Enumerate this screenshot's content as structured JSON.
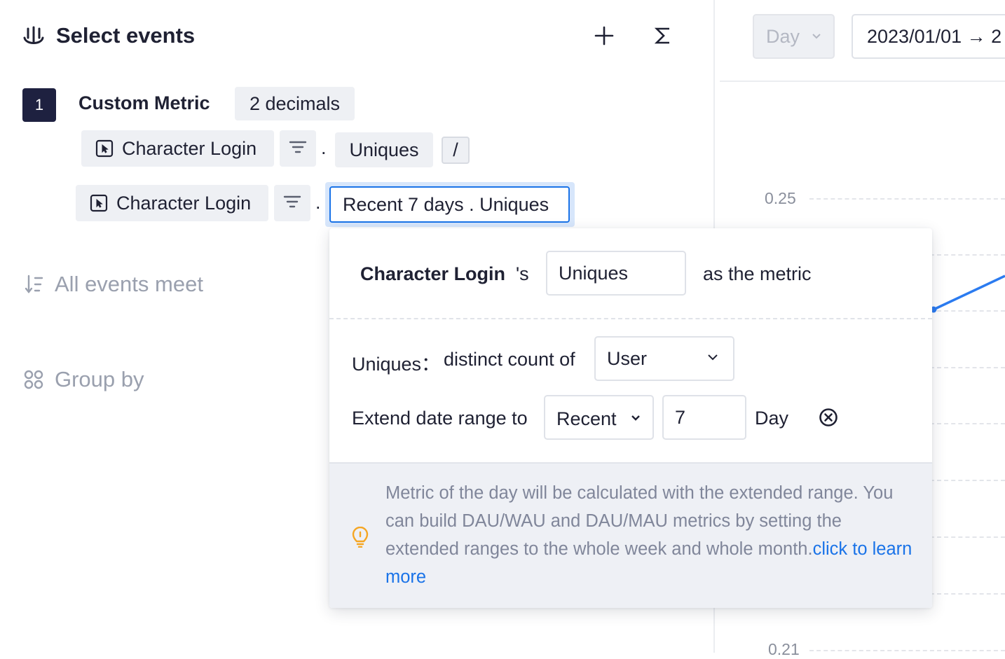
{
  "header": {
    "title": "Select events",
    "add_icon": "plus-icon",
    "formula_icon": "sigma-icon",
    "events_icon": "anchor-icon"
  },
  "metric": {
    "index": "1",
    "name": "Custom Metric",
    "decimals": "2 decimals",
    "row1": {
      "event": "Character Login",
      "separator": ".",
      "measure": "Uniques",
      "operator": "/"
    },
    "row2": {
      "event": "Character Login",
      "separator": ".",
      "measure": "Recent 7 days . Uniques"
    }
  },
  "sections": {
    "all_events": "All events meet",
    "group_by": "Group by"
  },
  "toolbar": {
    "granularity": "Day",
    "date_range": "2023/01/01 → 2"
  },
  "chart": {
    "tick_top": "0.25",
    "tick_bottom": "0.21",
    "line_color": "#2b7bf0"
  },
  "popup": {
    "event_name": "Character Login",
    "possessive": "'s",
    "metric_value": "Uniques",
    "as_metric": "as the metric",
    "uniques_label": "Uniques：",
    "distinct_label": "distinct count of",
    "distinct_value": "User",
    "extend_label": "Extend date range to",
    "range_mode": "Recent",
    "range_amount": "7",
    "range_unit": "Day",
    "tip_text": "Metric of the day will be calculated with the extended range. You can build DAU/WAU and DAU/MAU metrics by setting the extended ranges to the whole week and whole month.",
    "tip_link": "click to learn more"
  },
  "colors": {
    "accent": "#1a73e8",
    "index_badge": "#1e2140",
    "tip_bulb": "#f5a623"
  }
}
